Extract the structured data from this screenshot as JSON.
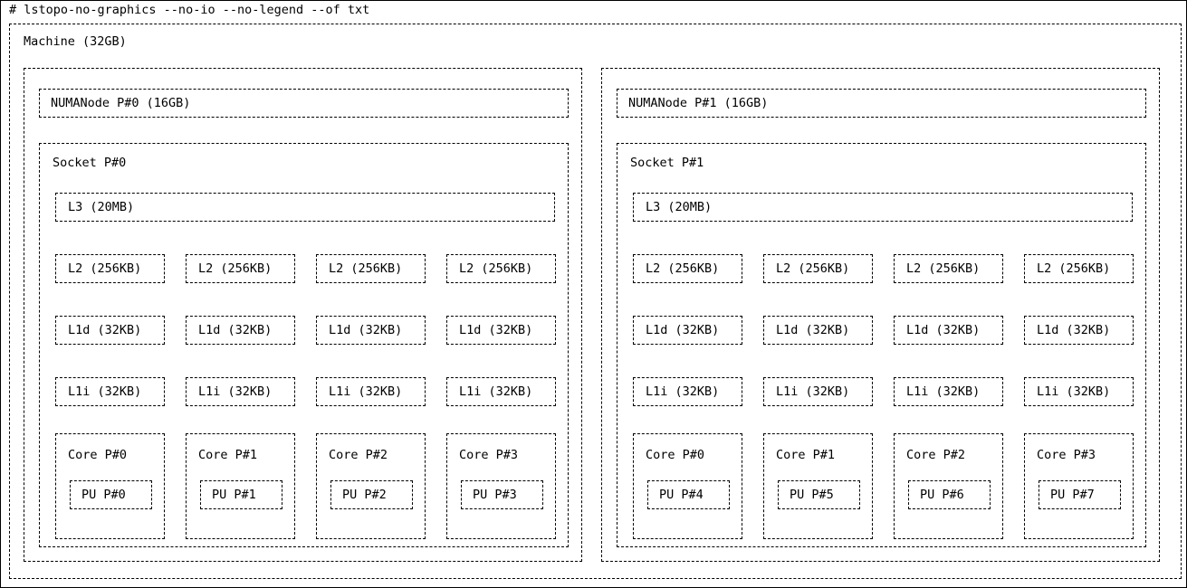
{
  "command": "# lstopo-no-graphics --no-io --no-legend --of txt",
  "machine": {
    "label": "Machine (32GB)"
  },
  "groups": [
    {
      "numanode": "NUMANode P#0 (16GB)",
      "socket": "Socket P#0",
      "l3": "L3 (20MB)",
      "l2": [
        "L2 (256KB)",
        "L2 (256KB)",
        "L2 (256KB)",
        "L2 (256KB)"
      ],
      "l1d": [
        "L1d (32KB)",
        "L1d (32KB)",
        "L1d (32KB)",
        "L1d (32KB)"
      ],
      "l1i": [
        "L1i (32KB)",
        "L1i (32KB)",
        "L1i (32KB)",
        "L1i (32KB)"
      ],
      "cores": [
        {
          "label": "Core P#0",
          "pu": "PU P#0"
        },
        {
          "label": "Core P#1",
          "pu": "PU P#1"
        },
        {
          "label": "Core P#2",
          "pu": "PU P#2"
        },
        {
          "label": "Core P#3",
          "pu": "PU P#3"
        }
      ]
    },
    {
      "numanode": "NUMANode P#1 (16GB)",
      "socket": "Socket P#1",
      "l3": "L3 (20MB)",
      "l2": [
        "L2 (256KB)",
        "L2 (256KB)",
        "L2 (256KB)",
        "L2 (256KB)"
      ],
      "l1d": [
        "L1d (32KB)",
        "L1d (32KB)",
        "L1d (32KB)",
        "L1d (32KB)"
      ],
      "l1i": [
        "L1i (32KB)",
        "L1i (32KB)",
        "L1i (32KB)",
        "L1i (32KB)"
      ],
      "cores": [
        {
          "label": "Core P#0",
          "pu": "PU P#4"
        },
        {
          "label": "Core P#1",
          "pu": "PU P#5"
        },
        {
          "label": "Core P#2",
          "pu": "PU P#6"
        },
        {
          "label": "Core P#3",
          "pu": "PU P#7"
        }
      ]
    }
  ],
  "colors": {
    "background": "#ffffff",
    "line": "#000000",
    "text": "#000000"
  }
}
